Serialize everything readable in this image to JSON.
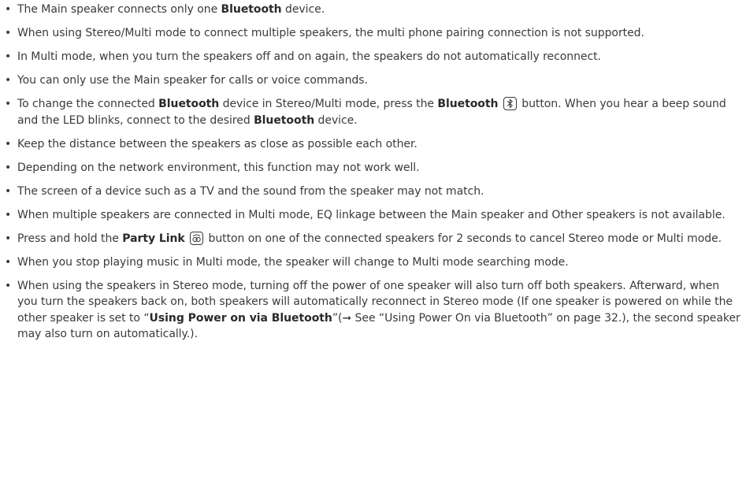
{
  "bullet_char": "•",
  "icons": {
    "bluetooth_button": "bluetooth-icon",
    "party_link_button": "party-link-icon",
    "see_arrow": "arrow-right-icon"
  },
  "notes": [
    {
      "p1": "The Main speaker connects only one ",
      "b1": "Bluetooth",
      "p2": " device."
    },
    {
      "text": "When using Stereo/Multi mode to connect multiple speakers, the multi phone pairing connection is not supported."
    },
    {
      "text": "In Multi mode, when you turn the speakers off and on again, the speakers do not automatically reconnect."
    },
    {
      "text": "You can only use the Main speaker for calls or voice commands."
    },
    {
      "p1": "To change the connected ",
      "b1": "Bluetooth",
      "p2": " device in Stereo/Multi mode, press the ",
      "b2": "Bluetooth",
      "p3": " button. When you hear a beep sound and the LED blinks, connect to the desired ",
      "b3": "Bluetooth",
      "p4": " device."
    },
    {
      "text": "Keep the distance between the speakers as close as possible each other."
    },
    {
      "text": "Depending on the network environment, this function may not work well."
    },
    {
      "text": "The screen of a device such as a TV and the sound from the speaker may not match."
    },
    {
      "text": "When multiple speakers are connected in Multi mode, EQ linkage between the Main speaker and Other speakers is not available."
    },
    {
      "p1": "Press and hold the ",
      "b1": "Party Link",
      "p2": " button on one of the connected speakers for 2 seconds to cancel Stereo mode or Multi mode."
    },
    {
      "text": "When you stop playing music in Multi mode, the speaker will change to Multi mode searching mode."
    },
    {
      "p1": "When using the speakers in Stereo mode, turning off the power of one speaker will also turn off both speakers. Afterward, when you turn the speakers back on, both speakers will automatically reconnect in Stereo mode (If one speaker is powered on while the other speaker is set to “",
      "b1": "Using Power on via Bluetooth",
      "p2": "”(",
      "arrow": "➞",
      "p3": " See “Using Power On via Bluetooth” on page 32.), the second speaker may also turn on automatically.)."
    }
  ]
}
